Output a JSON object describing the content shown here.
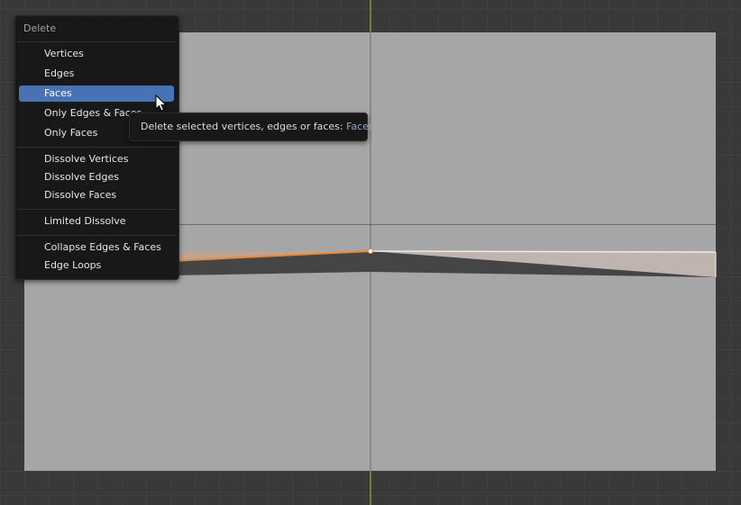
{
  "menu": {
    "title": "Delete",
    "items": [
      {
        "label": "Vertices",
        "active": false
      },
      {
        "label": "Edges",
        "active": false
      },
      {
        "label": "Faces",
        "active": true
      },
      {
        "label": "Only Edges & Faces",
        "active": false
      },
      {
        "label": "Only Faces",
        "active": false
      },
      {
        "label": "Dissolve Vertices",
        "active": false
      },
      {
        "label": "Dissolve Edges",
        "active": false
      },
      {
        "label": "Dissolve Faces",
        "active": false
      },
      {
        "label": "Limited Dissolve",
        "active": false
      },
      {
        "label": "Collapse Edges & Faces",
        "active": false
      },
      {
        "label": "Edge Loops",
        "active": false
      }
    ]
  },
  "tooltip": {
    "text": "Delete selected vertices, edges or faces:",
    "value": "Faces"
  },
  "colors": {
    "background": "#393939",
    "mesh_face": "#a6a6a6",
    "selection": "#e8883a",
    "menu_highlight": "#4772b3",
    "y_axis": "#7aa12a"
  }
}
